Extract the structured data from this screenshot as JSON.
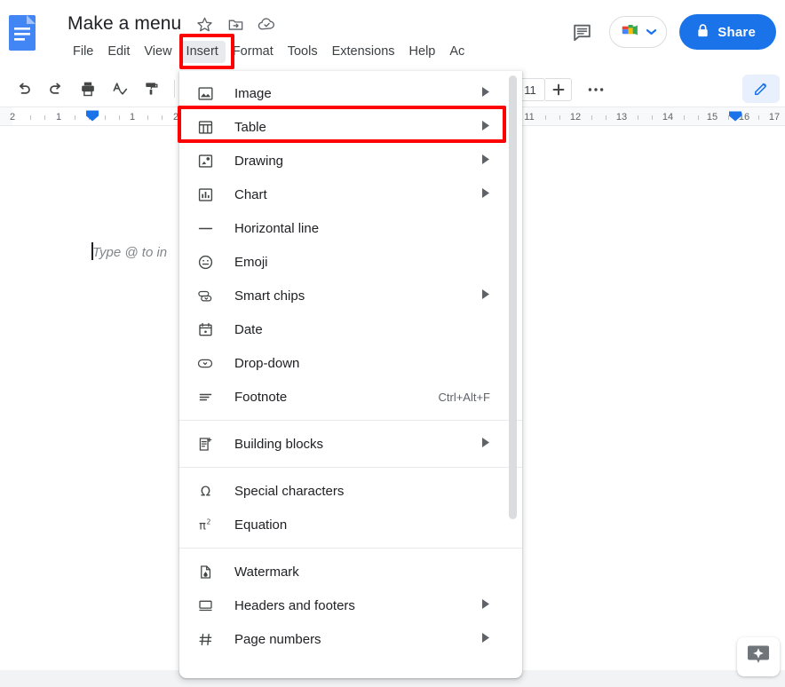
{
  "app": {
    "name": "Google Docs",
    "doc_icon": "docs-icon"
  },
  "header": {
    "title": "Make a menu",
    "title_icons": [
      {
        "name": "star-icon",
        "label": "Star"
      },
      {
        "name": "move-to-folder-icon",
        "label": "Move"
      },
      {
        "name": "cloud-saved-icon",
        "label": "Saved to Drive"
      }
    ],
    "menubar": [
      {
        "label": "File",
        "active": false
      },
      {
        "label": "Edit",
        "active": false
      },
      {
        "label": "View",
        "active": false
      },
      {
        "label": "Insert",
        "active": true
      },
      {
        "label": "Format",
        "active": false
      },
      {
        "label": "Tools",
        "active": false
      },
      {
        "label": "Extensions",
        "active": false
      },
      {
        "label": "Help",
        "active": false
      },
      {
        "label": "Ac",
        "active": false
      }
    ],
    "comment_icon": "comment-history-icon",
    "meet_icon": "google-meet-icon",
    "meet_caret": "chevron-down-icon",
    "share": {
      "label": "Share",
      "icon": "lock-icon",
      "color": "#1a73e8"
    }
  },
  "toolbar": {
    "items": [
      {
        "name": "undo-icon",
        "label": "Undo"
      },
      {
        "name": "redo-icon",
        "label": "Redo"
      },
      {
        "name": "print-icon",
        "label": "Print"
      },
      {
        "name": "spelling-check-icon",
        "label": "Spelling and grammar check"
      },
      {
        "name": "paint-format-icon",
        "label": "Paint format"
      }
    ],
    "zoom_value": "11",
    "plus_icon": "plus-icon",
    "more_icon": "more-options-icon",
    "edit_mode_icon": "pencil-icon"
  },
  "ruler": {
    "left_ticks": [
      "2",
      "1"
    ],
    "right_ticks": [
      "1",
      "2"
    ],
    "far_right_ticks": [
      "11",
      "12",
      "13",
      "14",
      "15",
      "16",
      "17"
    ],
    "indent_marker": "indent-marker-icon"
  },
  "document": {
    "placeholder": "Type @ to in",
    "caret": "text-caret"
  },
  "insert_menu": {
    "groups": [
      {
        "items": [
          {
            "label": "Image",
            "icon": "image-icon",
            "submenu": true,
            "accel": "",
            "highlighted": false
          },
          {
            "label": "Table",
            "icon": "table-icon",
            "submenu": true,
            "accel": "",
            "highlighted": true
          },
          {
            "label": "Drawing",
            "icon": "drawing-icon",
            "submenu": true,
            "accel": "",
            "highlighted": false
          },
          {
            "label": "Chart",
            "icon": "chart-icon",
            "submenu": true,
            "accel": "",
            "highlighted": false
          },
          {
            "label": "Horizontal line",
            "icon": "horizontal-line-icon",
            "submenu": false,
            "accel": "",
            "highlighted": false
          },
          {
            "label": "Emoji",
            "icon": "emoji-icon",
            "submenu": false,
            "accel": "",
            "highlighted": false
          },
          {
            "label": "Smart chips",
            "icon": "smart-chips-icon",
            "submenu": true,
            "accel": "",
            "highlighted": false
          },
          {
            "label": "Date",
            "icon": "date-icon",
            "submenu": false,
            "accel": "",
            "highlighted": false
          },
          {
            "label": "Drop-down",
            "icon": "drop-down-icon",
            "submenu": false,
            "accel": "",
            "highlighted": false
          },
          {
            "label": "Footnote",
            "icon": "footnote-icon",
            "submenu": false,
            "accel": "Ctrl+Alt+F",
            "highlighted": false
          }
        ]
      },
      {
        "items": [
          {
            "label": "Building blocks",
            "icon": "building-blocks-icon",
            "submenu": true,
            "accel": "",
            "highlighted": false
          }
        ]
      },
      {
        "items": [
          {
            "label": "Special characters",
            "icon": "omega-icon",
            "submenu": false,
            "accel": "",
            "highlighted": false
          },
          {
            "label": "Equation",
            "icon": "equation-icon",
            "submenu": false,
            "accel": "",
            "highlighted": false
          }
        ]
      },
      {
        "items": [
          {
            "label": "Watermark",
            "icon": "watermark-icon",
            "submenu": false,
            "accel": "",
            "highlighted": false
          },
          {
            "label": "Headers and footers",
            "icon": "headers-footers-icon",
            "submenu": true,
            "accel": "",
            "highlighted": false
          },
          {
            "label": "Page numbers",
            "icon": "page-numbers-icon",
            "submenu": true,
            "accel": "",
            "highlighted": false
          }
        ]
      }
    ],
    "scrollbar": "menu-scrollbar"
  },
  "annotations": {
    "color": "#ff0000",
    "boxes": [
      {
        "target": "Insert",
        "name": "insert-menu-highlight"
      },
      {
        "target": "Table",
        "name": "table-item-highlight"
      }
    ]
  },
  "assistant": {
    "icon": "gemini-sparkle-icon",
    "label": "AI assistant"
  }
}
